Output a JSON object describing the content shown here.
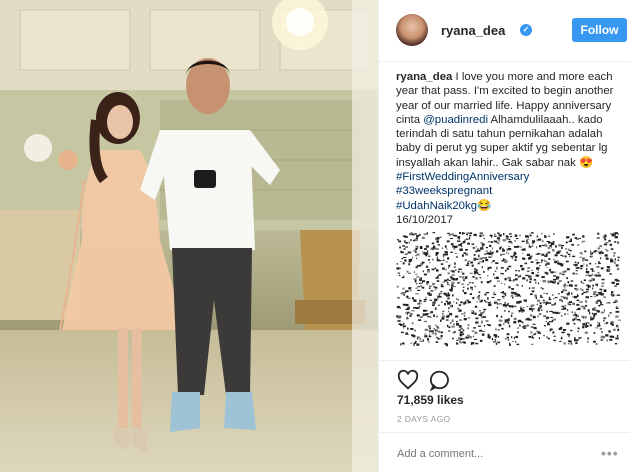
{
  "post": {
    "username": "ryana_dea",
    "follow_label": "Follow",
    "caption_lines": [
      "I love you more and more each",
      "year that pass. I'm excited to begin another",
      "year of our married life. Happy anniversary",
      "cinta",
      "Alhamdulilaaah.. kado",
      "terindah di satu tahun pernikahan adalah",
      "baby di perut yg super aktif yg sebentar lg",
      "insyallah akan lahir.. Gak sabar nak"
    ],
    "mention": "@puadinredi",
    "hashtags": [
      "#FirstWeddingAnniversary",
      "#33weekspregnant",
      "#UdahNaik20kg"
    ],
    "date_line": "16/10/2017",
    "emoji_heart_eyes": "😍",
    "emoji_laugh": "😂",
    "likes": "71,859 likes",
    "timestamp": "2 DAYS AGO",
    "comment_placeholder": "Add a comment...",
    "more_label": "•••"
  },
  "colors": {
    "accent": "#3897f0",
    "link": "#003569",
    "muted": "#999999"
  },
  "icons": [
    "verified-badge-icon",
    "heart-icon",
    "comment-bubble-icon",
    "more-options-icon"
  ]
}
